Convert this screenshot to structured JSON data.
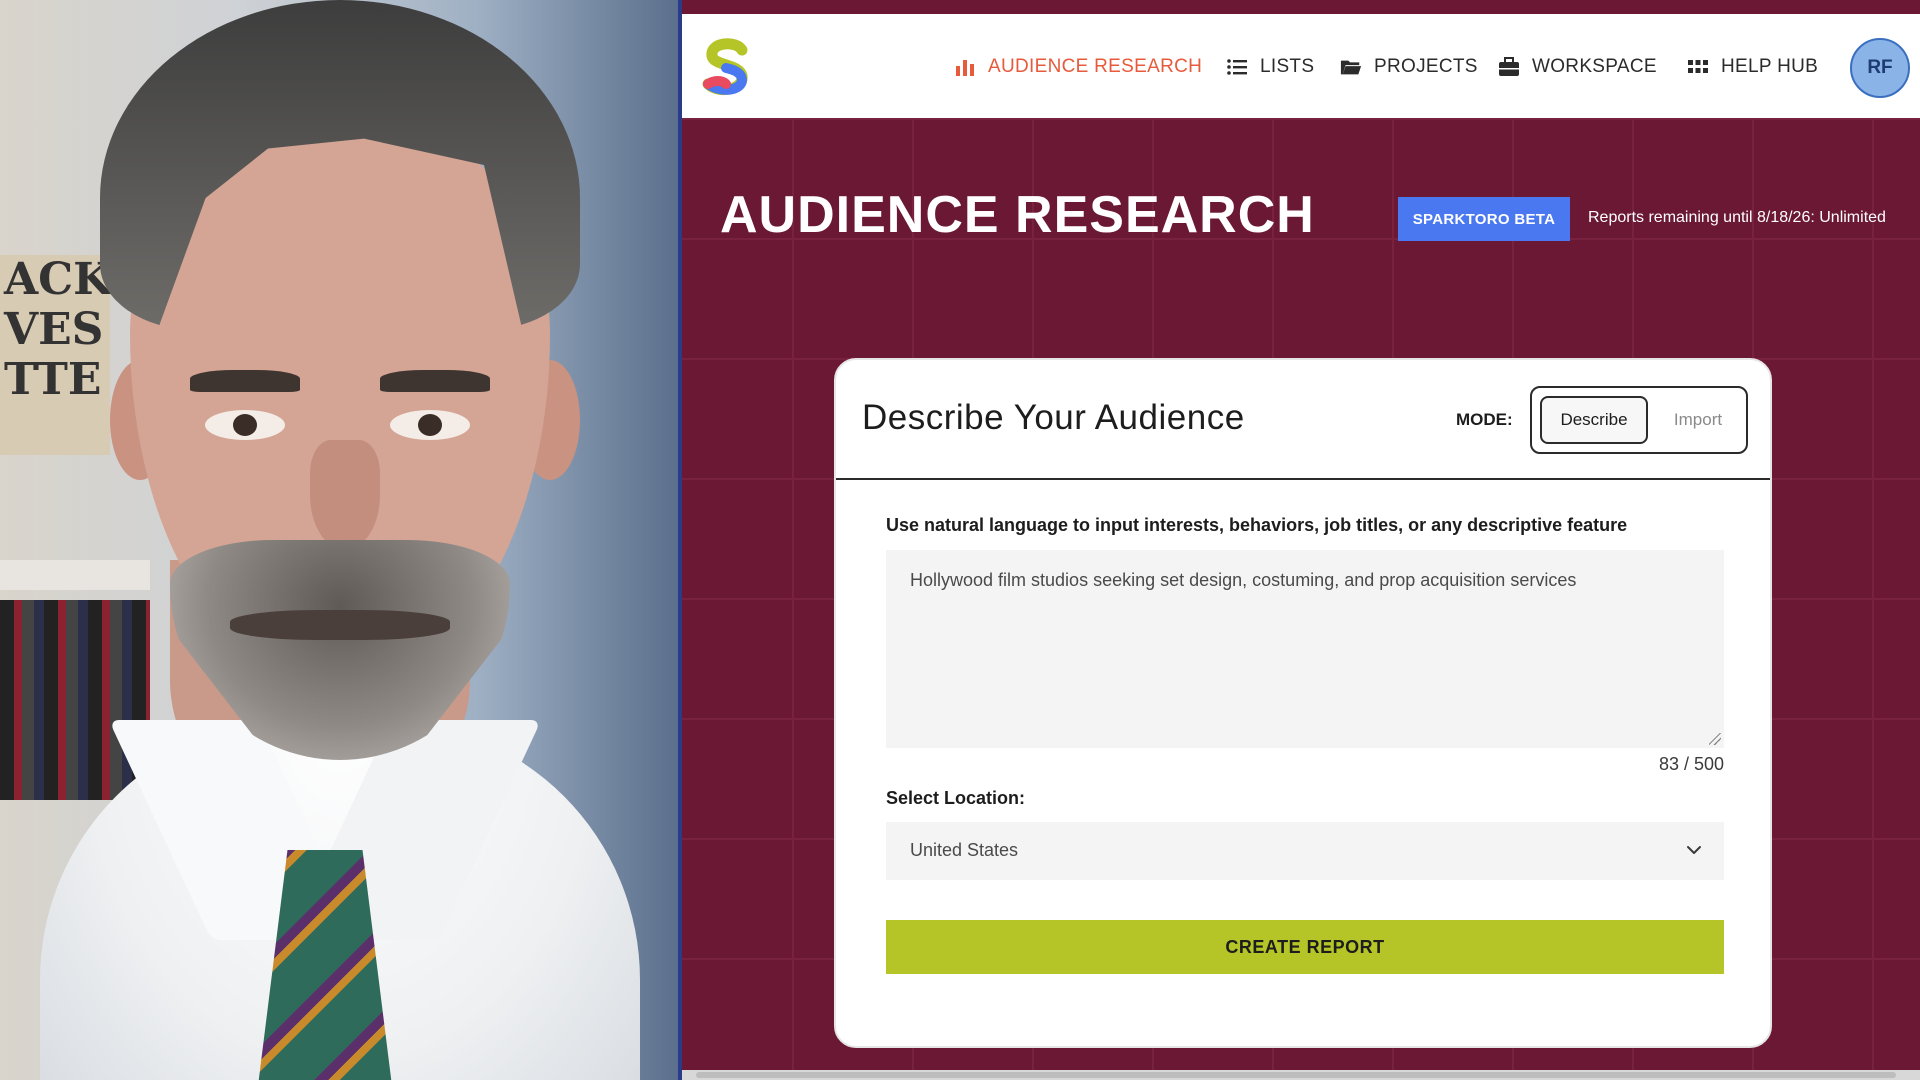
{
  "nav": {
    "items": [
      {
        "label": "AUDIENCE RESEARCH",
        "icon": "bar-chart-icon",
        "active": true
      },
      {
        "label": "LISTS",
        "icon": "list-icon",
        "active": false
      },
      {
        "label": "PROJECTS",
        "icon": "folder-icon",
        "active": false
      },
      {
        "label": "WORKSPACE",
        "icon": "briefcase-icon",
        "active": false
      },
      {
        "label": "HELP HUB",
        "icon": "grid-icon",
        "active": false
      }
    ],
    "avatar_initials": "RF",
    "logo_letter": "S"
  },
  "header": {
    "title": "AUDIENCE RESEARCH",
    "badge": "SPARKTORO BETA",
    "reports_remaining": "Reports remaining until 8/18/26: Unlimited"
  },
  "card": {
    "title": "Describe Your Audience",
    "mode_label": "MODE:",
    "modes": [
      "Describe",
      "Import"
    ],
    "active_mode": "Describe",
    "instruction": "Use natural language to input interests, behaviors, job titles, or any descriptive feature",
    "textarea_value": "Hollywood film studios seeking set design, costuming, and prop acquisition services",
    "char_count": "83 / 500",
    "location_label": "Select Location:",
    "location_value": "United States",
    "submit_label": "CREATE REPORT"
  },
  "colors": {
    "brand_maroon": "#6b1834",
    "accent_orange": "#e75b3c",
    "badge_blue": "#4a78f0",
    "button_green": "#b5c527"
  },
  "webcam": {
    "sign_text": "ACK\nVES\nTTE"
  }
}
